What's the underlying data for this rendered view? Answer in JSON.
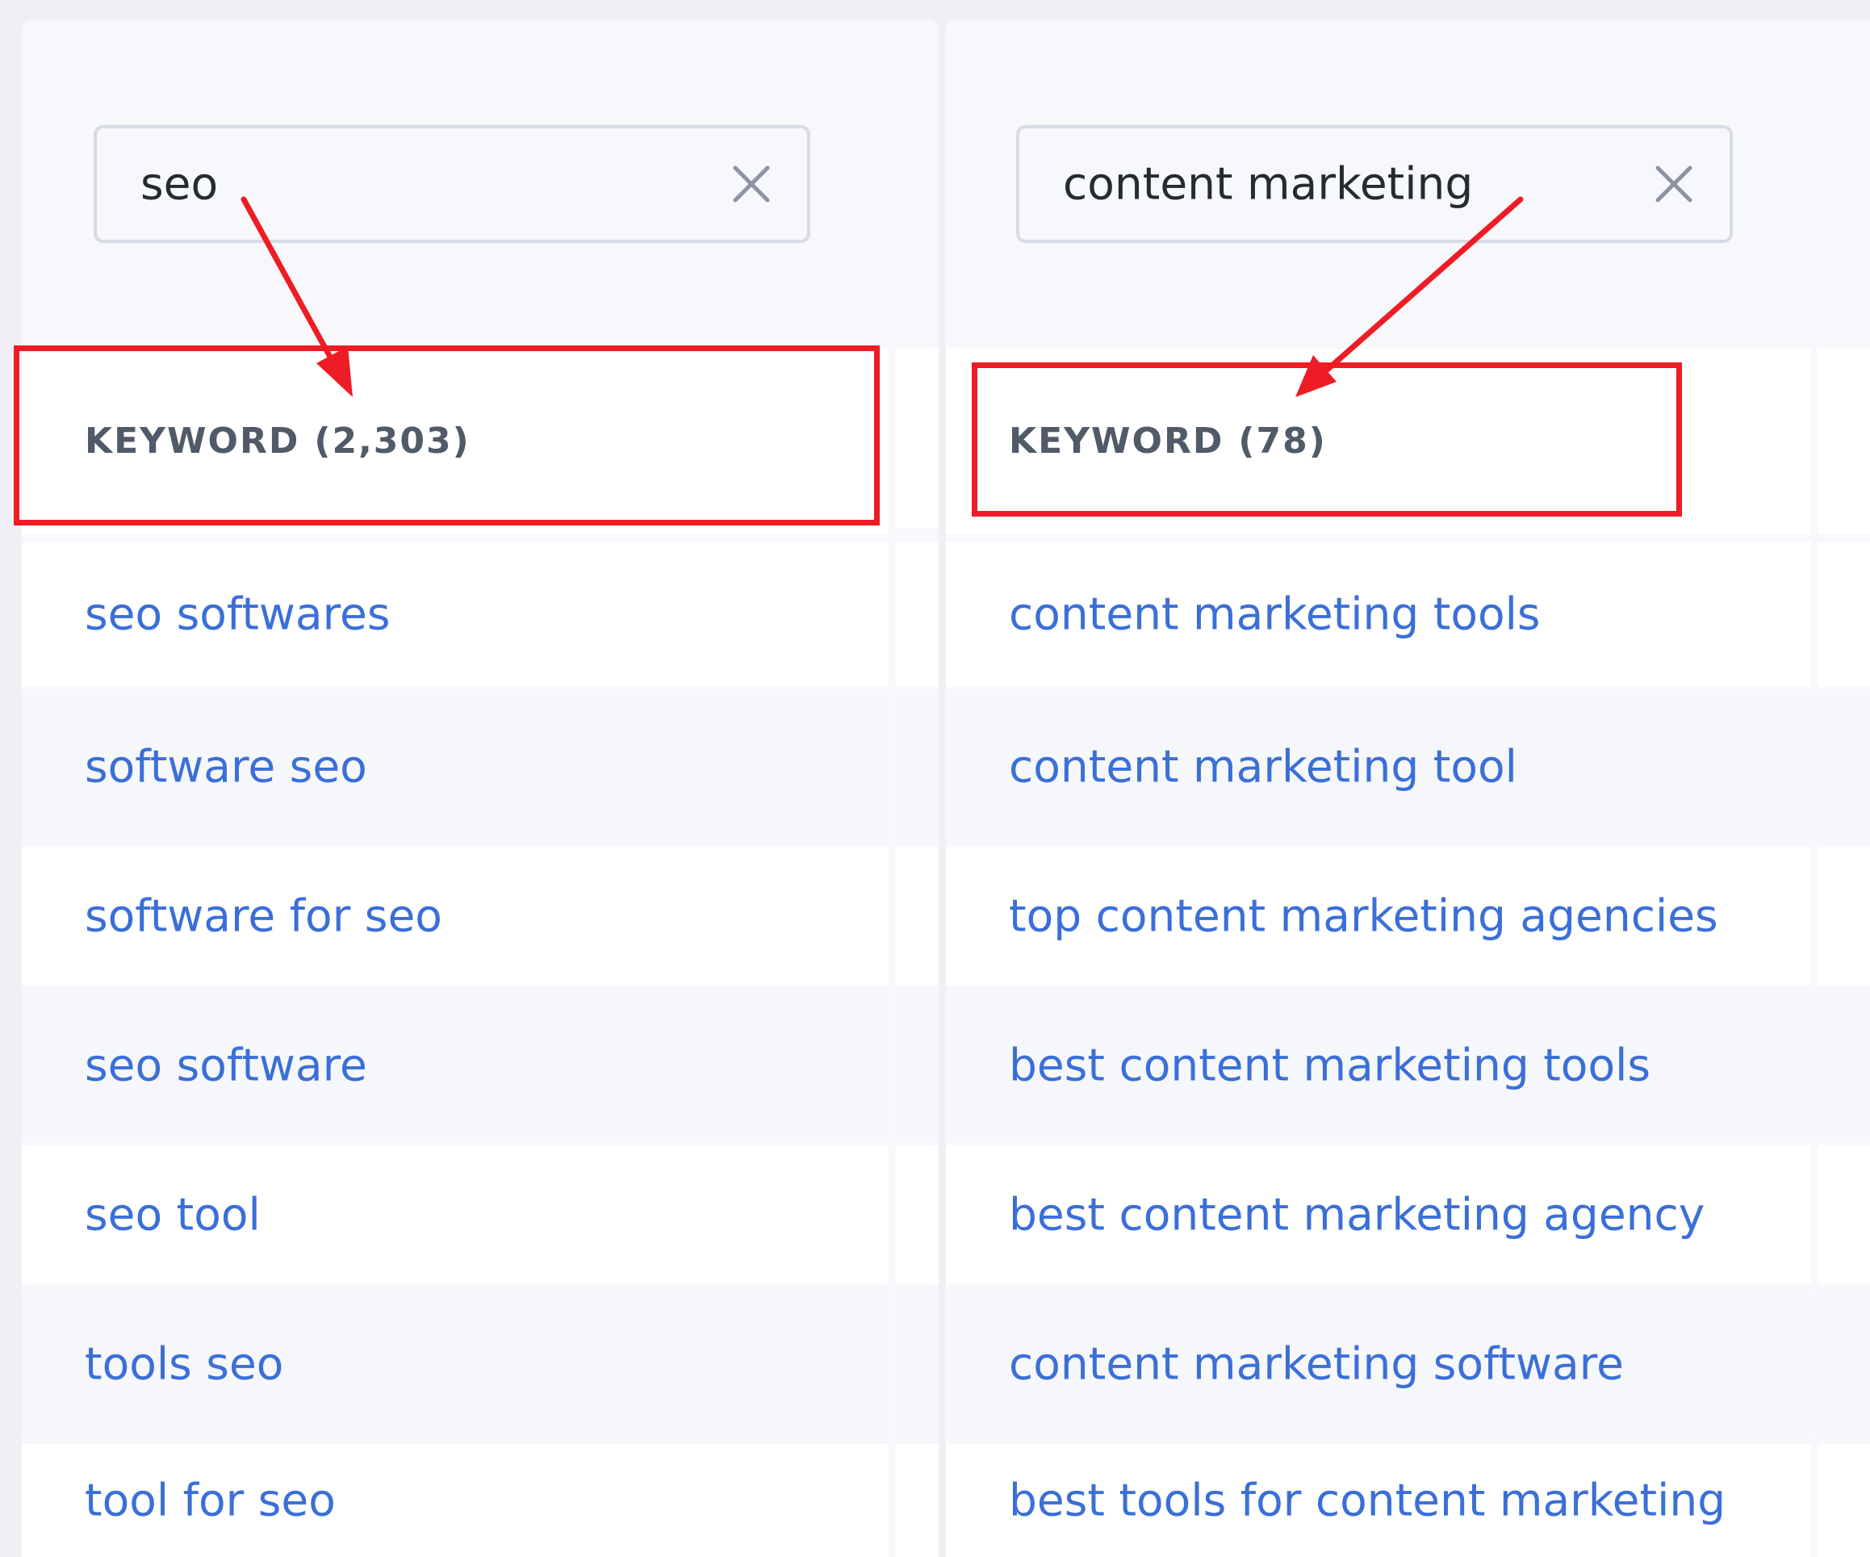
{
  "left_column": {
    "search_value": "seo",
    "clear_icon": "close-icon",
    "header_label": "KEYWORD",
    "header_count": "(2,303)",
    "keywords": [
      "seo softwares",
      "software seo",
      "software for seo",
      "seo software",
      "seo tool",
      "tools seo",
      "tool for seo"
    ]
  },
  "right_column": {
    "search_value": "content marketing",
    "clear_icon": "close-icon",
    "header_label": "KEYWORD",
    "header_count": "(78)",
    "keywords": [
      "content marketing tools",
      "content marketing tool",
      "top content marketing agencies",
      "best content marketing tools",
      "best content marketing agency",
      "content marketing software",
      "best tools for content marketing"
    ]
  },
  "colors": {
    "link": "#3b6fd8",
    "annotation": "#ee1c24",
    "header_text": "#505a68"
  }
}
